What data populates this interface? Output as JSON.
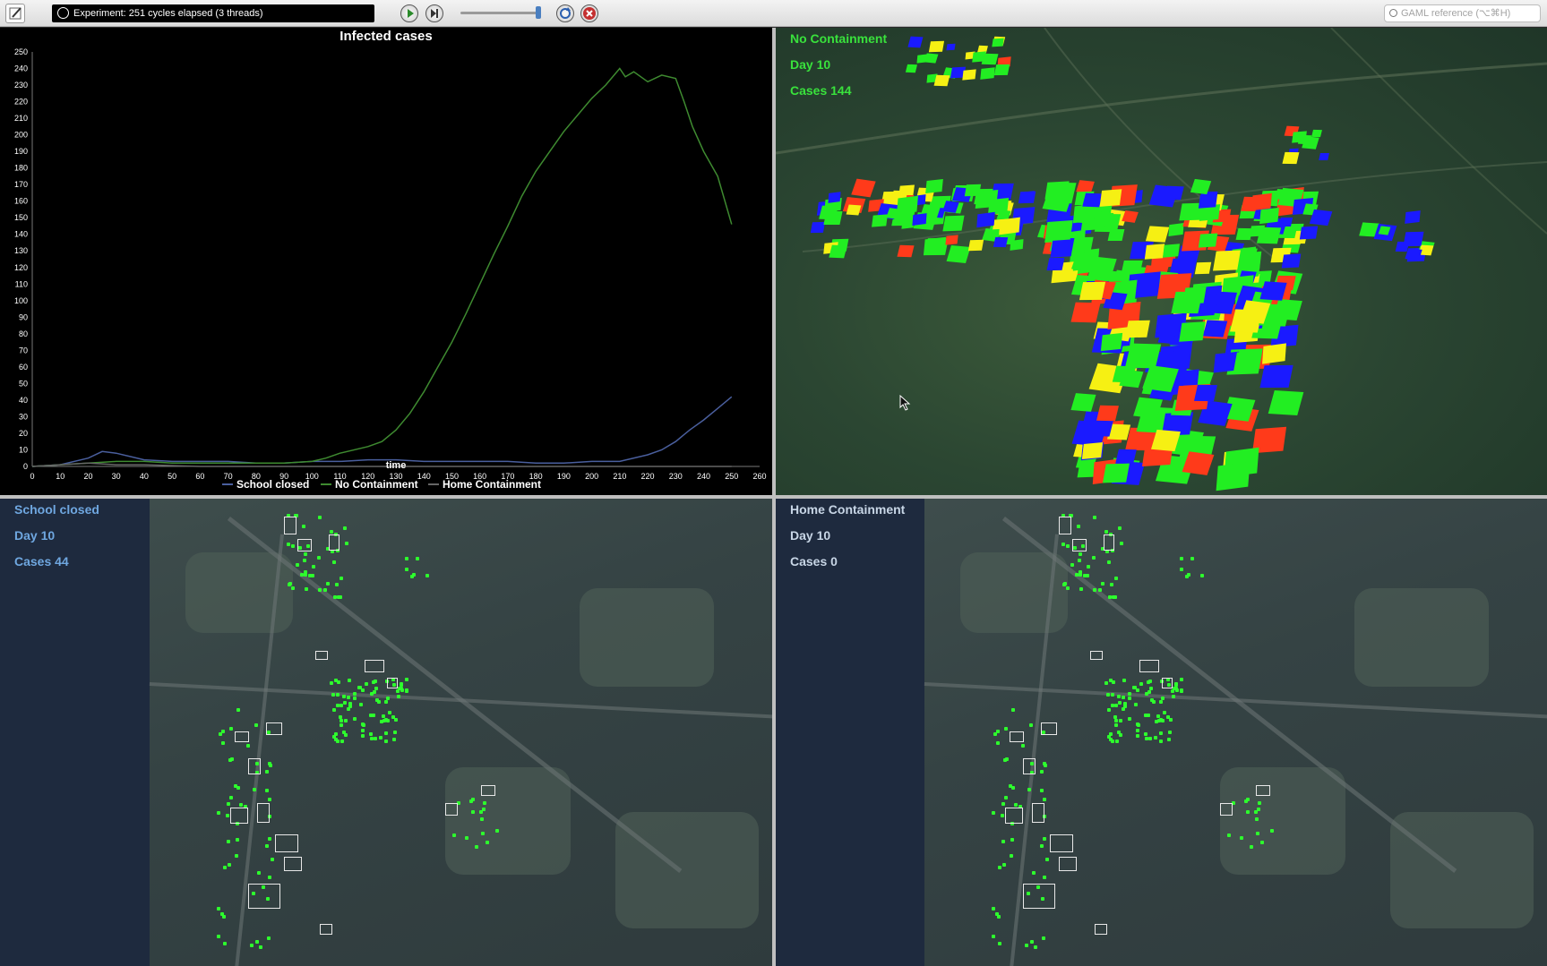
{
  "toolbar": {
    "status": "Experiment: 251 cycles elapsed (3 threads)",
    "search_placeholder": "GAML reference (⌥⌘H)"
  },
  "chart_data": {
    "type": "line",
    "title": "Infected cases",
    "xlabel": "time",
    "ylabel": "",
    "xlim": [
      0,
      260
    ],
    "ylim": [
      0,
      250
    ],
    "x_ticks": [
      0,
      10,
      20,
      30,
      40,
      50,
      60,
      70,
      80,
      90,
      100,
      110,
      120,
      130,
      140,
      150,
      160,
      170,
      180,
      190,
      200,
      210,
      220,
      230,
      240,
      250,
      260
    ],
    "y_ticks": [
      0,
      10,
      20,
      30,
      40,
      50,
      60,
      70,
      80,
      90,
      100,
      110,
      120,
      130,
      140,
      150,
      160,
      170,
      180,
      190,
      200,
      210,
      220,
      230,
      240,
      250
    ],
    "grid": false,
    "legend_position": "bottom",
    "series": [
      {
        "name": "School closed",
        "color": "#4a5f9e",
        "x": [
          0,
          10,
          20,
          25,
          30,
          40,
          50,
          60,
          70,
          80,
          90,
          100,
          110,
          120,
          130,
          140,
          150,
          160,
          170,
          180,
          190,
          200,
          210,
          220,
          225,
          230,
          235,
          240,
          245,
          250
        ],
        "y": [
          0,
          1,
          5,
          9,
          8,
          4,
          3,
          3,
          3,
          2,
          2,
          3,
          3,
          4,
          4,
          3,
          3,
          3,
          3,
          2,
          2,
          3,
          3,
          7,
          10,
          15,
          22,
          28,
          35,
          42
        ]
      },
      {
        "name": "No Containment",
        "color": "#3e8a30",
        "x": [
          0,
          10,
          20,
          30,
          40,
          50,
          60,
          70,
          80,
          90,
          100,
          105,
          110,
          120,
          125,
          130,
          135,
          140,
          145,
          150,
          155,
          160,
          165,
          170,
          175,
          180,
          185,
          190,
          195,
          200,
          205,
          210,
          212,
          215,
          220,
          225,
          230,
          233,
          236,
          240,
          245,
          250
        ],
        "y": [
          0,
          1,
          2,
          3,
          3,
          2,
          2,
          2,
          2,
          2,
          3,
          5,
          8,
          12,
          15,
          22,
          32,
          45,
          60,
          75,
          92,
          110,
          128,
          145,
          163,
          178,
          190,
          202,
          212,
          222,
          230,
          240,
          235,
          238,
          232,
          236,
          234,
          220,
          205,
          190,
          175,
          146
        ]
      },
      {
        "name": "Home Containment",
        "color": "#666666",
        "x": [
          0,
          20,
          30,
          40,
          60,
          100,
          150,
          200,
          250
        ],
        "y": [
          0,
          2,
          1,
          1,
          0,
          0,
          0,
          0,
          0
        ]
      }
    ]
  },
  "views": {
    "top_right": {
      "title": "No Containment",
      "day": "Day 10",
      "cases": "Cases 144",
      "text_color": "#39e23c"
    },
    "bottom_left": {
      "title": "School closed",
      "day": "Day 10",
      "cases": "Cases 44",
      "text_color": "#6fa7e0"
    },
    "bottom_right": {
      "title": "Home Containment",
      "day": "Day 10",
      "cases": "Cases 0",
      "text_color": "#c8d6e6"
    }
  },
  "colors": {
    "susceptible": "#1a1aff",
    "recovered": "#22ee22",
    "infected": "#ff3a1a",
    "exposed": "#f6f013",
    "chart_bg": "#000000",
    "sidebar_bg": "#1e2a3e"
  },
  "icons": [
    "edit-icon",
    "clock-icon",
    "play-icon",
    "step-icon",
    "reload-icon",
    "close-icon",
    "search-icon"
  ]
}
